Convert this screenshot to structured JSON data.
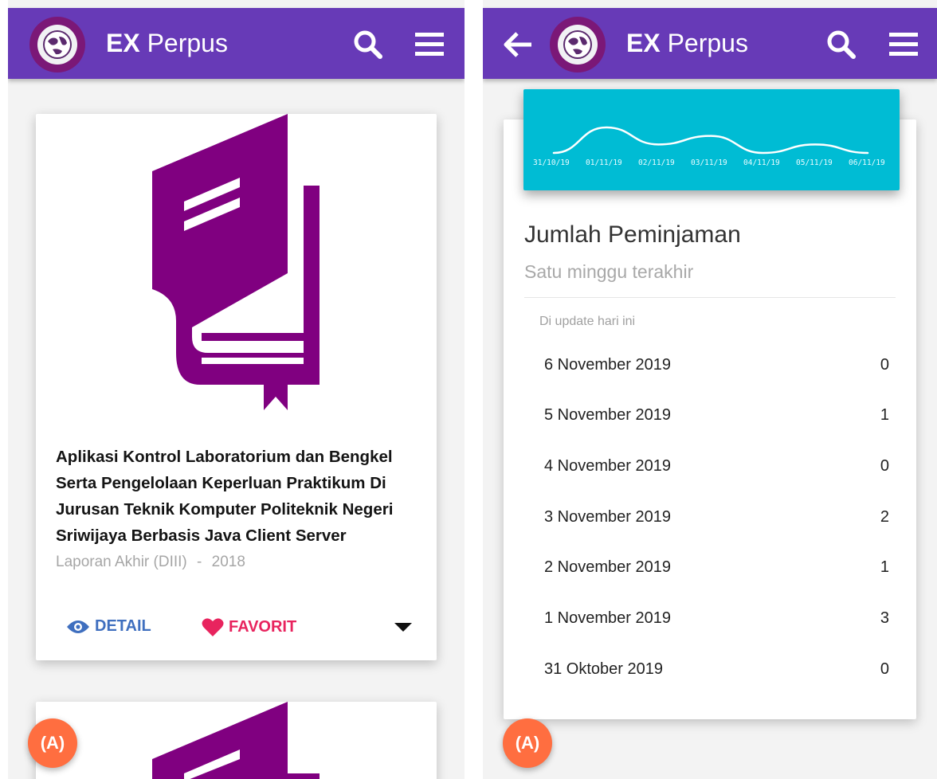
{
  "app": {
    "brand_bold": "EX",
    "brand_rest": " Perpus"
  },
  "colors": {
    "appbar": "#673ab7",
    "logo_ring": "#7b1877",
    "book_icon": "#800080",
    "detail": "#3f6fbf",
    "favorite": "#e8245e",
    "chart_bg": "#00bcd4",
    "fab": "#ff6e40"
  },
  "icons": {
    "logo": "globe-logo-icon",
    "search": "search-icon",
    "menu": "hamburger-menu-icon",
    "back": "arrow-left-icon",
    "book": "book-icon",
    "detail": "eye-icon",
    "favorite": "heart-icon",
    "expand": "caret-down-icon",
    "fab": "broadcast-a-icon"
  },
  "left": {
    "book": {
      "title": "Aplikasi Kontrol Laboratorium dan Bengkel Serta Pengelolaan Keperluan Praktikum Di Jurusan Teknik Komputer Politeknik Negeri Sriwijaya Berbasis Java Client Server",
      "type": "Laporan Akhir (DIII)",
      "separator": "-",
      "year": "2018"
    },
    "actions": {
      "detail": "DETAIL",
      "favorite": "FAVORIT"
    },
    "fab_label": "(A)"
  },
  "right": {
    "fab_label": "(A)",
    "section_title": "Jumlah Peminjaman",
    "section_subtitle": "Satu minggu terakhir",
    "updated": "Di update hari ini",
    "rows": [
      {
        "date": "6 November 2019",
        "count": "0"
      },
      {
        "date": "5 November 2019",
        "count": "1"
      },
      {
        "date": "4 November 2019",
        "count": "0"
      },
      {
        "date": "3 November 2019",
        "count": "2"
      },
      {
        "date": "2 November 2019",
        "count": "1"
      },
      {
        "date": "1 November 2019",
        "count": "3"
      },
      {
        "date": "31 Oktober 2019",
        "count": "0"
      }
    ]
  },
  "chart_data": {
    "type": "line",
    "categories": [
      "31/10/19",
      "01/11/19",
      "02/11/19",
      "03/11/19",
      "04/11/19",
      "05/11/19",
      "06/11/19"
    ],
    "values": [
      0,
      3,
      1,
      2,
      0,
      1,
      0
    ],
    "grid": false,
    "legend": "none"
  }
}
